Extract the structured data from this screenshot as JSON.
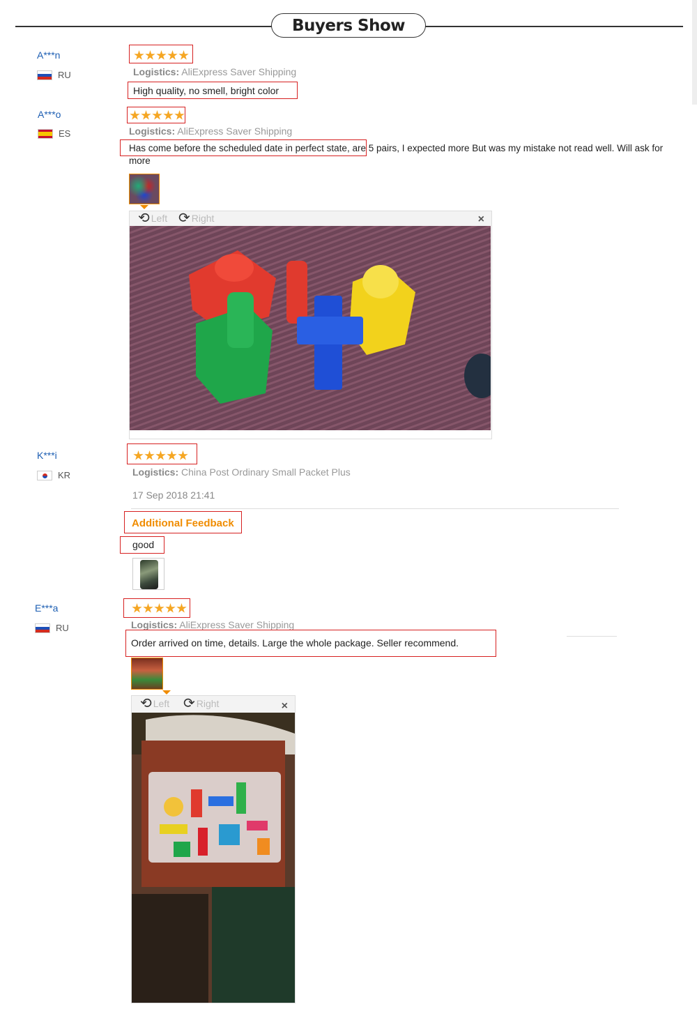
{
  "header": {
    "title": "Buyers Show"
  },
  "reviews": [
    {
      "user": "A***n",
      "country": "RU",
      "rating": 5,
      "logistics_label": "Logistics:",
      "logistics": "AliExpress Saver Shipping",
      "feedback": "High quality, no smell, bright color"
    },
    {
      "user": "A***o",
      "country": "ES",
      "rating": 5,
      "logistics_label": "Logistics:",
      "logistics": "AliExpress Saver Shipping",
      "feedback": "Has come before the scheduled date in perfect state, are 5 pairs, I expected more But was my mistake not read well. Will ask for more",
      "viewer": {
        "left_label": "Left",
        "right_label": "Right",
        "close": "×"
      }
    },
    {
      "user": "K***i",
      "country": "KR",
      "rating": 5,
      "logistics_label": "Logistics:",
      "logistics": "China Post Ordinary Small Packet Plus",
      "date": "17 Sep 2018 21:41",
      "additional_label": "Additional Feedback",
      "additional": "good"
    },
    {
      "user": "E***a",
      "country": "RU",
      "rating": 5,
      "logistics_label": "Logistics:",
      "logistics": "AliExpress Saver Shipping",
      "feedback": "Order arrived on time, details. Large the whole package. Seller recommend.",
      "viewer": {
        "left_label": "Left",
        "right_label": "Right",
        "close": "×"
      }
    }
  ],
  "colors": {
    "accent": "#f08c00",
    "star": "#f5a623",
    "username": "#1e5fb3",
    "highlight_box": "#d62020"
  }
}
